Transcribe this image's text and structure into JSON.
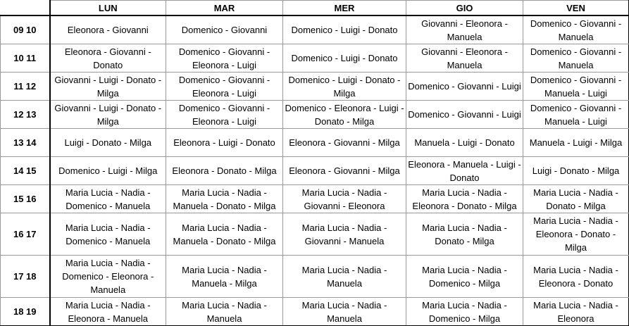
{
  "days": [
    "LUN",
    "MAR",
    "MER",
    "GIO",
    "VEN"
  ],
  "rows": [
    {
      "time": "09 10",
      "cells": [
        "Eleonora - Giovanni",
        "Domenico - Giovanni",
        "Domenico - Luigi - Donato",
        "Giovanni - Eleonora - Manuela",
        "Domenico - Giovanni - Manuela"
      ]
    },
    {
      "time": "10 11",
      "cells": [
        "Eleonora - Giovanni - Donato",
        "Domenico - Giovanni - Eleonora - Luigi",
        "Domenico - Luigi - Donato",
        "Giovanni - Eleonora - Manuela",
        "Domenico - Giovanni - Manuela"
      ]
    },
    {
      "time": "11 12",
      "cells": [
        "Giovanni - Luigi - Donato - Milga",
        "Domenico - Giovanni - Eleonora - Luigi",
        "Domenico - Luigi - Donato - Milga",
        "Domenico - Giovanni - Luigi",
        "Domenico - Giovanni - Manuela - Luigi"
      ]
    },
    {
      "time": "12 13",
      "cells": [
        "Giovanni - Luigi - Donato - Milga",
        "Domenico - Giovanni - Eleonora - Luigi",
        "Domenico - Eleonora - Luigi - Donato - Milga",
        "Domenico - Giovanni - Luigi",
        "Domenico - Giovanni - Manuela - Luigi"
      ]
    },
    {
      "time": "13 14",
      "cells": [
        "Luigi - Donato - Milga",
        "Eleonora - Luigi - Donato",
        "Eleonora - Giovanni - Milga",
        "Manuela - Luigi - Donato",
        "Manuela - Luigi - Milga"
      ]
    },
    {
      "time": "14 15",
      "cells": [
        "Domenico - Luigi - Milga",
        "Eleonora - Donato - Milga",
        "Eleonora - Giovanni - Milga",
        "Eleonora - Manuela - Luigi - Donato",
        "Luigi - Donato - Milga"
      ]
    },
    {
      "time": "15 16",
      "cells": [
        "Maria Lucia - Nadia - Domenico - Manuela",
        "Maria Lucia - Nadia - Manuela - Donato - Milga",
        "Maria Lucia - Nadia - Giovanni - Eleonora",
        "Maria Lucia - Nadia - Eleonora - Donato - Milga",
        "Maria Lucia - Nadia - Donato - Milga"
      ]
    },
    {
      "time": "16 17",
      "cells": [
        "Maria Lucia - Nadia - Domenico - Manuela",
        "Maria Lucia - Nadia - Manuela - Donato - Milga",
        "Maria Lucia - Nadia - Giovanni - Manuela",
        "Maria Lucia - Nadia - Donato - Milga",
        "Maria Lucia - Nadia - Eleonora - Donato - Milga"
      ]
    },
    {
      "time": "17 18",
      "cells": [
        "Maria Lucia - Nadia - Domenico - Eleonora - Manuela",
        "Maria Lucia - Nadia - Manuela - Milga",
        "Maria Lucia - Nadia - Manuela",
        "Maria Lucia - Nadia - Domenico - Milga",
        "Maria Lucia - Nadia - Eleonora - Donato"
      ]
    },
    {
      "time": "18 19",
      "cells": [
        "Maria Lucia - Nadia - Eleonora - Manuela",
        "Maria Lucia - Nadia - Manuela",
        "Maria Lucia - Nadia - Manuela",
        "Maria Lucia - Nadia - Domenico - Milga",
        "Maria Lucia - Nadia - Eleonora"
      ]
    }
  ]
}
